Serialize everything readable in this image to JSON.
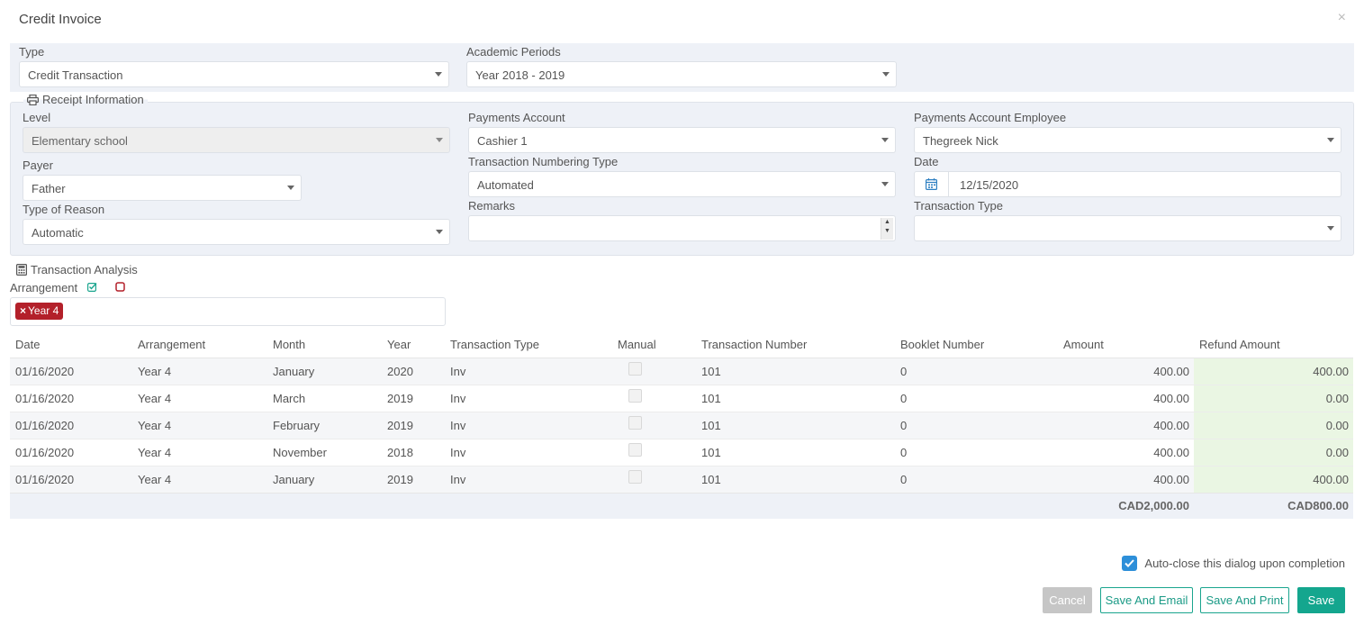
{
  "dialog": {
    "title": "Credit Invoice",
    "close_glyph": "×"
  },
  "top": {
    "type_label": "Type",
    "type_value": "Credit Transaction",
    "periods_label": "Academic Periods",
    "periods_value": "Year 2018 - 2019"
  },
  "receipt": {
    "legend": "Receipt Information",
    "legend_icon": "printer-icon",
    "level_label": "Level",
    "level_value": "Elementary school",
    "payments_account_label": "Payments Account",
    "payments_account_value": "Cashier 1",
    "employee_label": "Payments Account Employee",
    "employee_value": "Thegreek Nick",
    "payer_label": "Payer",
    "payer_value": "Father",
    "numbering_label": "Transaction Numbering Type",
    "numbering_value": "Automated",
    "date_label": "Date",
    "date_value": "12/15/2020",
    "reason_label": "Type of Reason",
    "reason_value": "Automatic",
    "remarks_label": "Remarks",
    "remarks_value": "",
    "transaction_type_label": "Transaction Type",
    "transaction_type_value": ""
  },
  "analysis": {
    "legend": "Transaction Analysis",
    "legend_icon": "calculator-icon",
    "arrangement_label": "Arrangement",
    "tags": [
      "Year 4"
    ],
    "tag_remove_glyph": "×",
    "colors": {
      "select_all": "#1aa58e",
      "deselect_all": "#b3202a",
      "tag": "#b3202a",
      "refund_cell": "#eaf6e3"
    }
  },
  "table": {
    "columns": [
      "Date",
      "Arrangement",
      "Month",
      "Year",
      "Transaction Type",
      "Manual",
      "Transaction Number",
      "Booklet Number",
      "Amount",
      "Refund Amount"
    ],
    "rows": [
      [
        "01/16/2020",
        "Year 4",
        "January",
        "2020",
        "Inv",
        "",
        "101",
        "0",
        "400.00",
        "400.00"
      ],
      [
        "01/16/2020",
        "Year 4",
        "March",
        "2019",
        "Inv",
        "",
        "101",
        "0",
        "400.00",
        "0.00"
      ],
      [
        "01/16/2020",
        "Year 4",
        "February",
        "2019",
        "Inv",
        "",
        "101",
        "0",
        "400.00",
        "0.00"
      ],
      [
        "01/16/2020",
        "Year 4",
        "November",
        "2018",
        "Inv",
        "",
        "101",
        "0",
        "400.00",
        "0.00"
      ],
      [
        "01/16/2020",
        "Year 4",
        "January",
        "2019",
        "Inv",
        "",
        "101",
        "0",
        "400.00",
        "400.00"
      ]
    ],
    "total_amount": "CAD2,000.00",
    "total_refund": "CAD800.00"
  },
  "footer": {
    "auto_close_label": "Auto-close this dialog upon completion",
    "auto_close_checked": true,
    "cancel_label": "Cancel",
    "save_email_label": "Save And Email",
    "save_print_label": "Save And Print",
    "save_label": "Save",
    "colors": {
      "primary": "#14a68e",
      "checkbox": "#2d8fd9",
      "cancel": "#c6c6c6"
    }
  }
}
